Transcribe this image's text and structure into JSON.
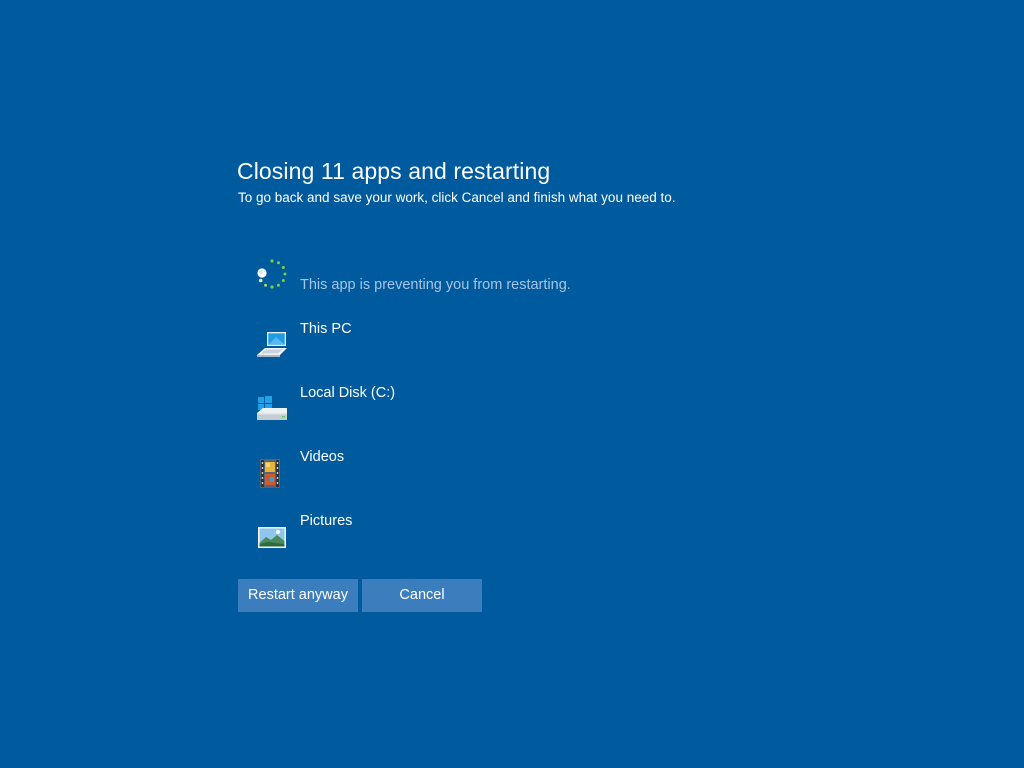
{
  "dialog": {
    "title": "Closing 11 apps and restarting",
    "subtitle": "To go back and save your work, click Cancel and finish what you need to.",
    "blocking_message": "This app is preventing you from restarting."
  },
  "apps": [
    {
      "label": "This PC",
      "icon": "computer-icon"
    },
    {
      "label": "Local Disk (C:)",
      "icon": "drive-icon"
    },
    {
      "label": "Videos",
      "icon": "videos-folder-icon"
    },
    {
      "label": "Pictures",
      "icon": "pictures-folder-icon"
    }
  ],
  "buttons": {
    "restart_label": "Restart anyway",
    "cancel_label": "Cancel"
  },
  "colors": {
    "background": "#005a9e",
    "button": "#3b7dbd",
    "muted_text": "#a6c4e4",
    "spinner": "#7fcf3a"
  }
}
